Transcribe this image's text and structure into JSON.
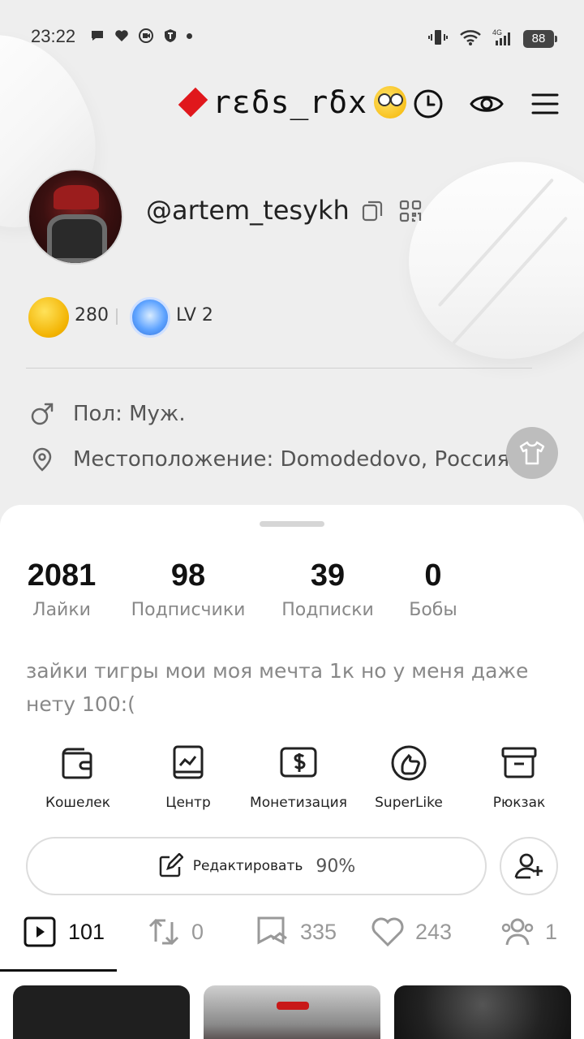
{
  "status_bar": {
    "time": "23:22",
    "battery": "88",
    "network": "4G"
  },
  "header": {
    "nickname": "rεδs_rδx",
    "icons": [
      "history-icon",
      "eye-icon",
      "menu-icon"
    ]
  },
  "profile": {
    "username": "@artem_tesykh",
    "coins": "280",
    "level": "LV 2",
    "gender": "Пол: Муж.",
    "location": "Местоположение: Domodedovo, Россия"
  },
  "stats": [
    {
      "value": "2081",
      "label": "Лайки"
    },
    {
      "value": "98",
      "label": "Подписчики"
    },
    {
      "value": "39",
      "label": "Подписки"
    },
    {
      "value": "0",
      "label": "Бобы"
    }
  ],
  "bio": "зайки тигры мои моя мечта 1к но у меня даже нету 100:(",
  "tools": [
    {
      "label": "Кошелек",
      "icon": "wallet-icon"
    },
    {
      "label": "Центр",
      "icon": "chart-icon"
    },
    {
      "label": "Монетизация",
      "icon": "dollar-icon"
    },
    {
      "label": "SuperLike",
      "icon": "superlike-icon"
    },
    {
      "label": "Рюкзак",
      "icon": "backpack-icon"
    }
  ],
  "edit": {
    "label": "Редактировать",
    "percent": "90%"
  },
  "tabs": [
    {
      "icon": "video-icon",
      "count": "101"
    },
    {
      "icon": "repost-icon",
      "count": "0"
    },
    {
      "icon": "collection-icon",
      "count": "335"
    },
    {
      "icon": "heart-icon",
      "count": "243"
    },
    {
      "icon": "group-icon",
      "count": "1"
    }
  ],
  "colors": {
    "accent_red": "#e0171c",
    "background": "#eeeeee",
    "sheet": "#ffffff"
  }
}
